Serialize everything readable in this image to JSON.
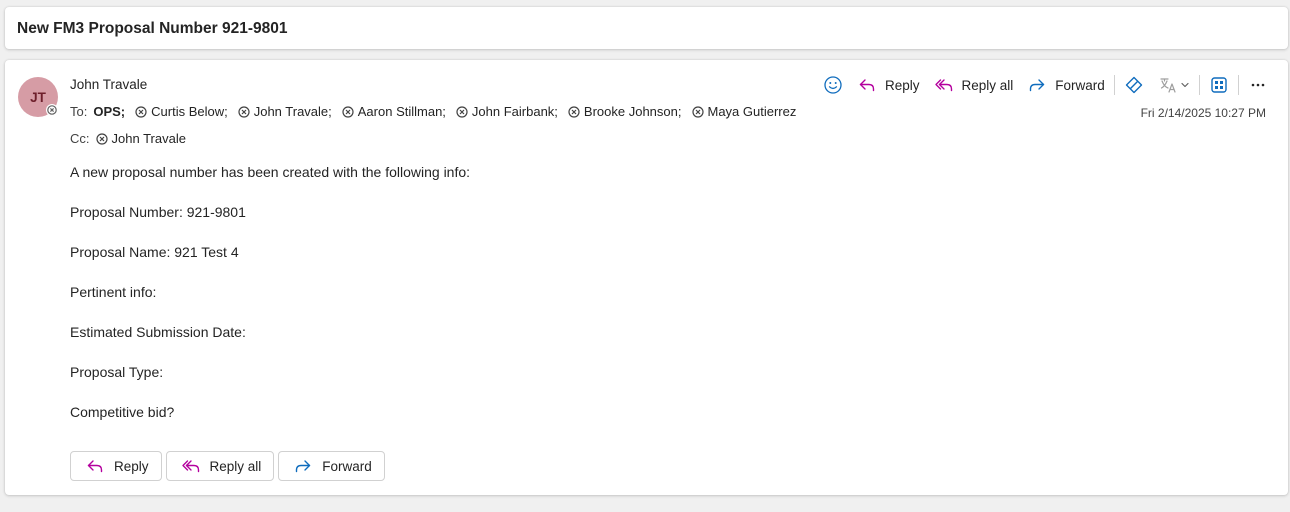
{
  "subject": "New FM3 Proposal Number 921-9801",
  "message": {
    "avatar_initials": "JT",
    "avatar_color": "#d69ca5",
    "sender": "John Travale",
    "to_prefix": "To:",
    "to_group": "OPS;",
    "to_recipients": [
      "Curtis Below;",
      "John Travale;",
      "Aaron Stillman;",
      "John Fairbank;",
      "Brooke Johnson;",
      "Maya Gutierrez"
    ],
    "cc_prefix": "Cc:",
    "cc_recipients": [
      "John Travale"
    ],
    "timestamp": "Fri 2/14/2025 10:27 PM"
  },
  "toolbar": {
    "emoji_icon": "smiley-icon",
    "reply_label": "Reply",
    "reply_all_label": "Reply all",
    "forward_label": "Forward",
    "reply_color": "#b4009e",
    "forward_color": "#0f6cbd",
    "sensitivity_icon": "tag-icon",
    "translate_icon": "translate-icon",
    "immersive_icon": "grid-view-icon",
    "more_icon": "more-options-icon"
  },
  "body": {
    "lines": [
      "A new proposal number has been created with the following info:",
      "Proposal Number:  921-9801",
      "Proposal Name:  921 Test 4",
      "Pertinent info:",
      "Estimated Submission Date:",
      "Proposal Type:",
      "Competitive bid?"
    ]
  },
  "actions": {
    "reply_label": "Reply",
    "reply_all_label": "Reply all",
    "forward_label": "Forward"
  }
}
